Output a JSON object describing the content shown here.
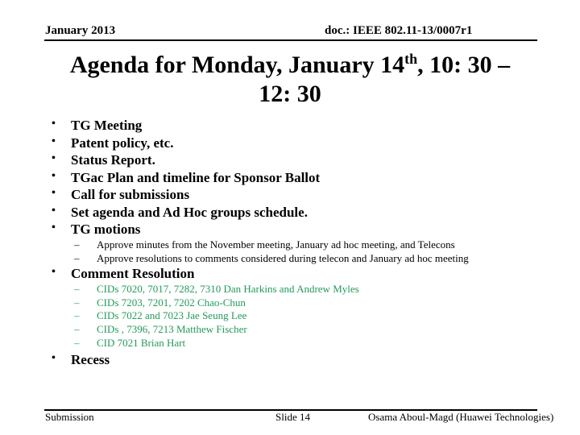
{
  "header": {
    "date": "January 2013",
    "doc": "doc.: IEEE 802.11-13/0007r1"
  },
  "title": {
    "part1": "Agenda for Monday, January 14",
    "sup": "th",
    "part2": ", 10: 30 –",
    "line2": "12: 30"
  },
  "agenda": {
    "items": [
      "TG Meeting",
      "Patent policy, etc.",
      "Status Report.",
      "TGac Plan and timeline for Sponsor Ballot",
      "Call for submissions",
      "Set agenda and Ad Hoc groups schedule.",
      "TG motions"
    ],
    "motions_sub": [
      "Approve minutes from the November meeting, January ad hoc meeting, and Telecons",
      "Approve resolutions to comments considered during telecon and January ad hoc meeting"
    ],
    "comment_resolution": "Comment Resolution",
    "comment_sub": [
      "CIDs 7020, 7017, 7282, 7310  Dan Harkins and Andrew Myles",
      "CIDs 7203, 7201, 7202   Chao-Chun",
      "CIDs 7022 and 7023   Jae Seung Lee",
      "CIDs , 7396, 7213   Matthew Fischer",
      "CID 7021 Brian Hart"
    ],
    "recess": "Recess",
    "bullet": "•",
    "dash": "–"
  },
  "footer": {
    "left": "Submission",
    "center": "Slide 14",
    "right": "Osama Aboul-Magd (Huawei Technologies)"
  },
  "colors": {
    "sub_item_green": "#239a5a"
  }
}
